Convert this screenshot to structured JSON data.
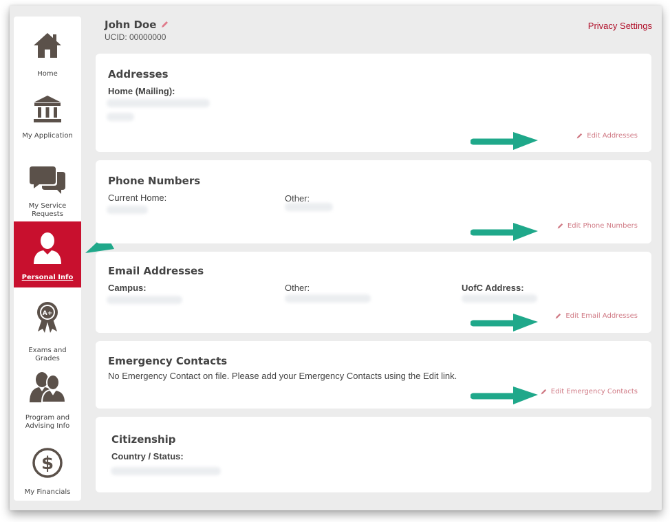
{
  "header": {
    "name": "John Doe",
    "ucid": "UCID: 00000000",
    "privacy_link": "Privacy Settings"
  },
  "sidebar": {
    "items": [
      {
        "label": "Home",
        "icon": "home-icon"
      },
      {
        "label": "My Application",
        "icon": "institution-icon"
      },
      {
        "label": "My Service Requests",
        "icon": "chat-bubbles-icon"
      },
      {
        "label": "Personal Info",
        "icon": "person-icon",
        "active": true
      },
      {
        "label": "Exams and Grades",
        "icon": "award-ribbon-icon"
      },
      {
        "label": "Program and Advising Info",
        "icon": "people-icon"
      },
      {
        "label": "My Financials",
        "icon": "dollar-circle-icon"
      }
    ]
  },
  "addresses": {
    "title": "Addresses",
    "home_label": "Home (Mailing):",
    "edit": "Edit Addresses"
  },
  "phones": {
    "title": "Phone Numbers",
    "home_label": "Current Home:",
    "other_label": "Other:",
    "edit": "Edit Phone Numbers"
  },
  "emails": {
    "title": "Email Addresses",
    "campus_label": "Campus:",
    "other_label": "Other:",
    "uofc_label": "UofC Address:",
    "edit": "Edit Email Addresses"
  },
  "emergency": {
    "title": "Emergency Contacts",
    "message": "No Emergency Contact on file. Please add your Emergency Contacts using the Edit link.",
    "edit": "Edit Emergency Contacts"
  },
  "citizenship": {
    "title": "Citizenship",
    "status_label": "Country / Status:"
  },
  "colors": {
    "accent": "#c8102e",
    "annotation_arrow": "#1fa88a",
    "edit_link": "#d07a85"
  }
}
